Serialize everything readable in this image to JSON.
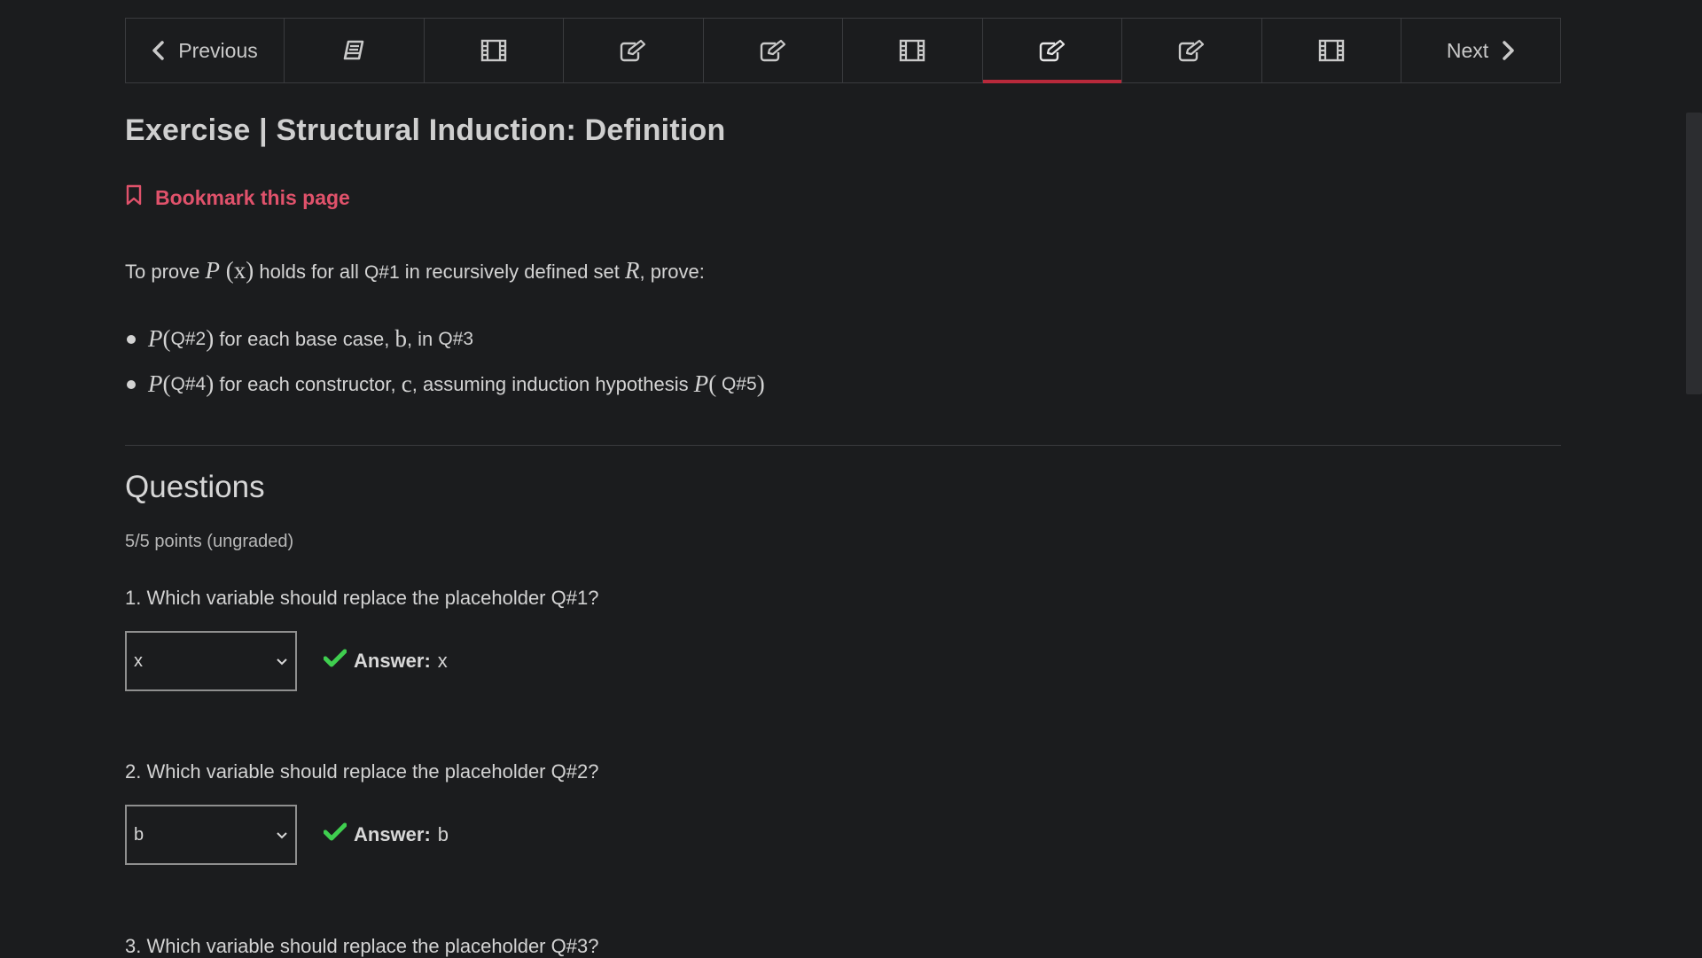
{
  "nav": {
    "previous_label": "Previous",
    "next_label": "Next",
    "tabs": [
      {
        "icon": "book-icon",
        "active": false
      },
      {
        "icon": "film-icon",
        "active": false
      },
      {
        "icon": "edit-icon",
        "active": false
      },
      {
        "icon": "edit-icon",
        "active": false
      },
      {
        "icon": "film-icon",
        "active": false
      },
      {
        "icon": "edit-icon",
        "active": true
      },
      {
        "icon": "edit-icon",
        "active": false
      },
      {
        "icon": "film-icon",
        "active": false
      }
    ]
  },
  "page": {
    "title": "Exercise | Structural Induction: Definition",
    "bookmark_label": "Bookmark this page"
  },
  "intro": {
    "t1": "To prove ",
    "m1": "P",
    "m2": "(x)",
    "t2": " holds for all ",
    "q1": "Q#1",
    "t3": " in recursively defined set ",
    "m3": "R",
    "t4": ", prove:"
  },
  "bullets": [
    {
      "p": "P",
      "open": "(",
      "ph": "Q#2",
      "close": ")",
      "t1": " for each base case, ",
      "v": "b",
      "t2": ", in ",
      "ph2": "Q#3"
    },
    {
      "p": "P",
      "open": "(",
      "ph": "Q#4",
      "close": ")",
      "t1": " for each constructor, ",
      "v": "c",
      "t2": ", assuming induction hypothesis ",
      "p2": "P",
      "open2": "(",
      "ph2": " Q#5",
      "close2": ")"
    }
  ],
  "questions_section": {
    "heading": "Questions",
    "points": "5/5 points (ungraded)"
  },
  "questions": [
    {
      "text": "1. Which variable should replace the placeholder Q#1?",
      "selected": "x",
      "answer_label": "Answer:",
      "answer_value": "x"
    },
    {
      "text": "2. Which variable should replace the placeholder Q#2?",
      "selected": "b",
      "answer_label": "Answer:",
      "answer_value": "b"
    },
    {
      "text": "3. Which variable should replace the placeholder Q#3?"
    }
  ],
  "colors": {
    "background": "#1b1c1e",
    "accent_red": "#b8293b",
    "bookmark_pink": "#e0526b",
    "check_green": "#3fce4f"
  }
}
